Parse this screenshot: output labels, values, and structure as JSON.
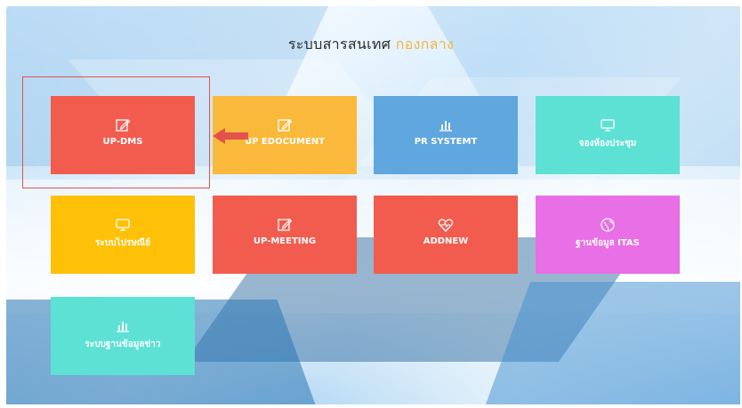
{
  "header": {
    "title_main": "ระบบสารสนเทศ",
    "title_accent": "กองกลาง"
  },
  "colors": {
    "red": "#f25c4f",
    "orange": "#fbb93b",
    "blue": "#5fa7de",
    "teal": "#5de1d4",
    "yellow": "#ffc107",
    "pink": "#e86fe6",
    "highlight": "#e2534b",
    "accent_text": "#f3b53b"
  },
  "tiles": [
    {
      "label": "UP-DMS",
      "icon": "edit-icon",
      "color": "#f25c4f"
    },
    {
      "label": "UP EDOCUMENT",
      "icon": "edit-icon",
      "color": "#fbb93b"
    },
    {
      "label": "PR SYSTEMT",
      "icon": "bar-chart-icon",
      "color": "#5fa7de"
    },
    {
      "label": "จองห้องประชุม",
      "icon": "monitor-icon",
      "color": "#5de1d4"
    },
    {
      "label": "ระบบไปรษณีย์",
      "icon": "monitor-icon",
      "color": "#ffc107"
    },
    {
      "label": "UP-MEETING",
      "icon": "edit-icon",
      "color": "#f25c4f"
    },
    {
      "label": "ADDNEW",
      "icon": "heartbeat-icon",
      "color": "#f25c4f"
    },
    {
      "label": "ฐานข้อมูล ITAS",
      "icon": "globe-icon",
      "color": "#e86fe6"
    },
    {
      "label": "ระบบฐานข้อมูลข่าว",
      "icon": "bar-chart-icon",
      "color": "#5de1d4"
    }
  ]
}
